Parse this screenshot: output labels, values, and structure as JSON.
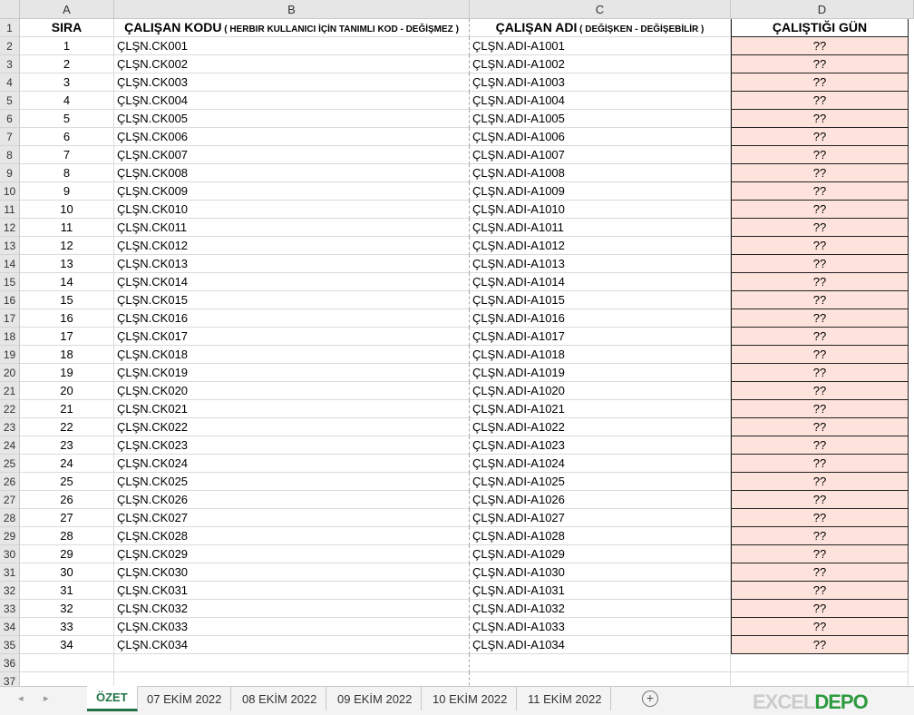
{
  "columns": [
    "A",
    "B",
    "C",
    "D"
  ],
  "header": {
    "sira": "SIRA",
    "kod_main": "ÇALIŞAN KODU",
    "kod_sub": " ( HERBIR KULLANICI İÇİN TANIMLI KOD - DEĞİŞMEZ )",
    "adi_main": "ÇALIŞAN ADI",
    "adi_sub": " ( DEĞİŞKEN  - DEĞİŞEBİLİR )",
    "gun": "ÇALIŞTIĞI GÜN"
  },
  "rows": [
    {
      "sira": "1",
      "kod": "ÇLŞN.CK001",
      "adi": "ÇLŞN.ADI-A1001",
      "gun": "??"
    },
    {
      "sira": "2",
      "kod": "ÇLŞN.CK002",
      "adi": "ÇLŞN.ADI-A1002",
      "gun": "??"
    },
    {
      "sira": "3",
      "kod": "ÇLŞN.CK003",
      "adi": "ÇLŞN.ADI-A1003",
      "gun": "??"
    },
    {
      "sira": "4",
      "kod": "ÇLŞN.CK004",
      "adi": "ÇLŞN.ADI-A1004",
      "gun": "??"
    },
    {
      "sira": "5",
      "kod": "ÇLŞN.CK005",
      "adi": "ÇLŞN.ADI-A1005",
      "gun": "??"
    },
    {
      "sira": "6",
      "kod": "ÇLŞN.CK006",
      "adi": "ÇLŞN.ADI-A1006",
      "gun": "??"
    },
    {
      "sira": "7",
      "kod": "ÇLŞN.CK007",
      "adi": "ÇLŞN.ADI-A1007",
      "gun": "??"
    },
    {
      "sira": "8",
      "kod": "ÇLŞN.CK008",
      "adi": "ÇLŞN.ADI-A1008",
      "gun": "??"
    },
    {
      "sira": "9",
      "kod": "ÇLŞN.CK009",
      "adi": "ÇLŞN.ADI-A1009",
      "gun": "??"
    },
    {
      "sira": "10",
      "kod": "ÇLŞN.CK010",
      "adi": "ÇLŞN.ADI-A1010",
      "gun": "??"
    },
    {
      "sira": "11",
      "kod": "ÇLŞN.CK011",
      "adi": "ÇLŞN.ADI-A1011",
      "gun": "??"
    },
    {
      "sira": "12",
      "kod": "ÇLŞN.CK012",
      "adi": "ÇLŞN.ADI-A1012",
      "gun": "??"
    },
    {
      "sira": "13",
      "kod": "ÇLŞN.CK013",
      "adi": "ÇLŞN.ADI-A1013",
      "gun": "??"
    },
    {
      "sira": "14",
      "kod": "ÇLŞN.CK014",
      "adi": "ÇLŞN.ADI-A1014",
      "gun": "??"
    },
    {
      "sira": "15",
      "kod": "ÇLŞN.CK015",
      "adi": "ÇLŞN.ADI-A1015",
      "gun": "??"
    },
    {
      "sira": "16",
      "kod": "ÇLŞN.CK016",
      "adi": "ÇLŞN.ADI-A1016",
      "gun": "??"
    },
    {
      "sira": "17",
      "kod": "ÇLŞN.CK017",
      "adi": "ÇLŞN.ADI-A1017",
      "gun": "??"
    },
    {
      "sira": "18",
      "kod": "ÇLŞN.CK018",
      "adi": "ÇLŞN.ADI-A1018",
      "gun": "??"
    },
    {
      "sira": "19",
      "kod": "ÇLŞN.CK019",
      "adi": "ÇLŞN.ADI-A1019",
      "gun": "??"
    },
    {
      "sira": "20",
      "kod": "ÇLŞN.CK020",
      "adi": "ÇLŞN.ADI-A1020",
      "gun": "??"
    },
    {
      "sira": "21",
      "kod": "ÇLŞN.CK021",
      "adi": "ÇLŞN.ADI-A1021",
      "gun": "??"
    },
    {
      "sira": "22",
      "kod": "ÇLŞN.CK022",
      "adi": "ÇLŞN.ADI-A1022",
      "gun": "??"
    },
    {
      "sira": "23",
      "kod": "ÇLŞN.CK023",
      "adi": "ÇLŞN.ADI-A1023",
      "gun": "??"
    },
    {
      "sira": "24",
      "kod": "ÇLŞN.CK024",
      "adi": "ÇLŞN.ADI-A1024",
      "gun": "??"
    },
    {
      "sira": "25",
      "kod": "ÇLŞN.CK025",
      "adi": "ÇLŞN.ADI-A1025",
      "gun": "??"
    },
    {
      "sira": "26",
      "kod": "ÇLŞN.CK026",
      "adi": "ÇLŞN.ADI-A1026",
      "gun": "??"
    },
    {
      "sira": "27",
      "kod": "ÇLŞN.CK027",
      "adi": "ÇLŞN.ADI-A1027",
      "gun": "??"
    },
    {
      "sira": "28",
      "kod": "ÇLŞN.CK028",
      "adi": "ÇLŞN.ADI-A1028",
      "gun": "??"
    },
    {
      "sira": "29",
      "kod": "ÇLŞN.CK029",
      "adi": "ÇLŞN.ADI-A1029",
      "gun": "??"
    },
    {
      "sira": "30",
      "kod": "ÇLŞN.CK030",
      "adi": "ÇLŞN.ADI-A1030",
      "gun": "??"
    },
    {
      "sira": "31",
      "kod": "ÇLŞN.CK031",
      "adi": "ÇLŞN.ADI-A1031",
      "gun": "??"
    },
    {
      "sira": "32",
      "kod": "ÇLŞN.CK032",
      "adi": "ÇLŞN.ADI-A1032",
      "gun": "??"
    },
    {
      "sira": "33",
      "kod": "ÇLŞN.CK033",
      "adi": "ÇLŞN.ADI-A1033",
      "gun": "??"
    },
    {
      "sira": "34",
      "kod": "ÇLŞN.CK034",
      "adi": "ÇLŞN.ADI-A1034",
      "gun": "??"
    }
  ],
  "extra_rows": [
    "36",
    "37"
  ],
  "sheet_tabs": [
    "ÖZET",
    "07 EKİM 2022",
    "08 EKİM 2022",
    "09 EKİM 2022",
    "10 EKİM 2022",
    "11 EKİM 2022"
  ],
  "active_tab": "ÖZET",
  "logo": {
    "part1": "EXCEL",
    "part2": "DEPO",
    "part3": "EXC"
  },
  "colors": {
    "fill_gun": "#fde3dc",
    "accent": "#217346",
    "logo_green": "#2e9b3f"
  }
}
